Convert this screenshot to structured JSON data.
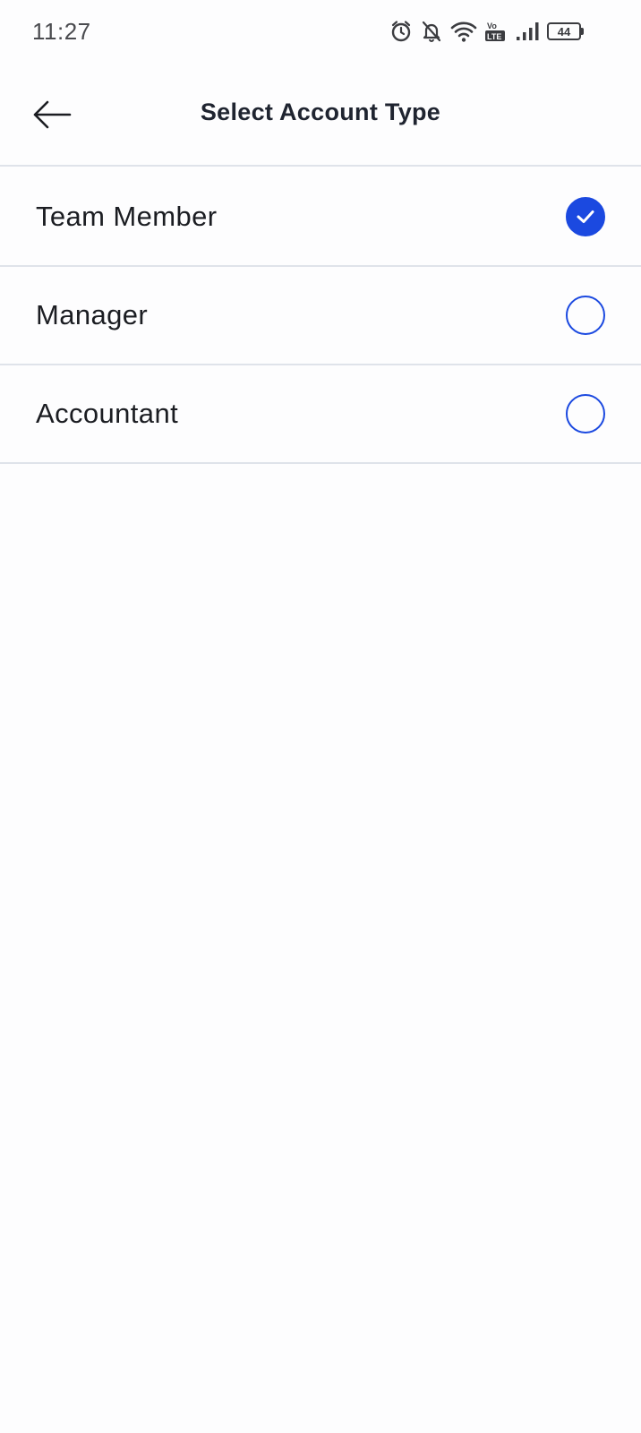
{
  "status_bar": {
    "time": "11:27",
    "battery_level": "44",
    "icons": [
      "alarm-icon",
      "bell-off-icon",
      "wifi-icon",
      "volte-icon",
      "signal-icon",
      "battery-icon"
    ]
  },
  "header": {
    "title": "Select Account Type",
    "back_icon": "arrow-left-icon"
  },
  "options": [
    {
      "label": "Team Member",
      "selected": true
    },
    {
      "label": "Manager",
      "selected": false
    },
    {
      "label": "Accountant",
      "selected": false
    }
  ],
  "colors": {
    "accent": "#1b49e0",
    "divider": "#dfe3ea",
    "text": "#1b1d22"
  }
}
